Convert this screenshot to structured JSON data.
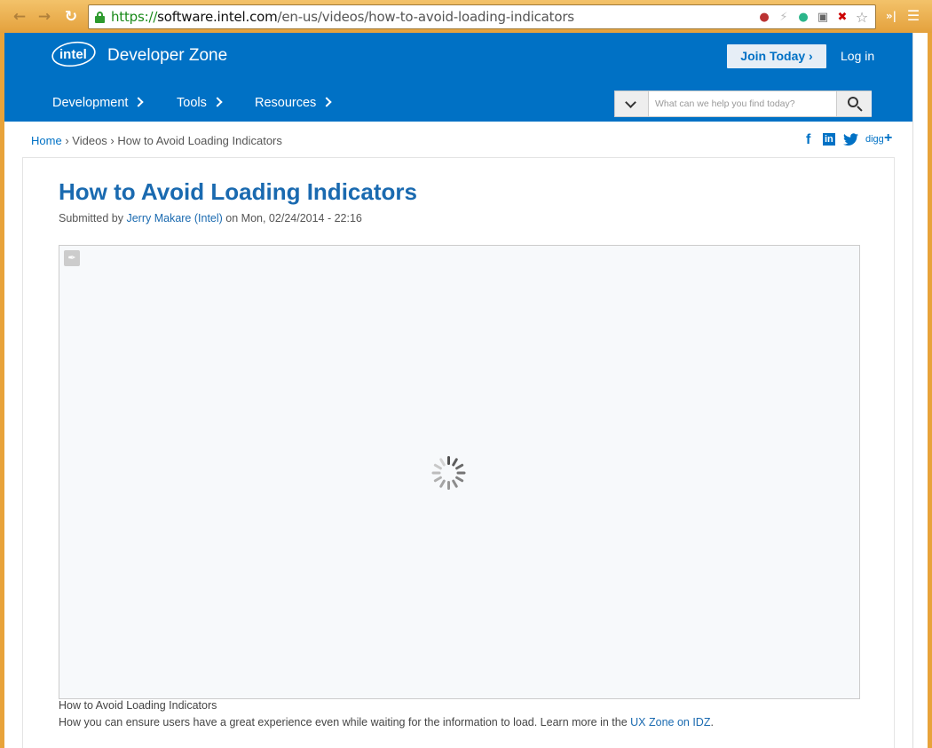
{
  "browser": {
    "url_scheme": "https://",
    "url_host": "software.intel.com",
    "url_path": "/en-us/videos/how-to-avoid-loading-indicators"
  },
  "header": {
    "logo_text": "intel",
    "title": "Developer Zone",
    "join_label": "Join Today",
    "login_label": "Log in",
    "nav": [
      "Development",
      "Tools",
      "Resources"
    ],
    "search_placeholder": "What can we help you find today?"
  },
  "breadcrumb": {
    "home": "Home",
    "sep": "›",
    "videos": "Videos",
    "current": "How to Avoid Loading Indicators"
  },
  "share": {
    "facebook": "f",
    "linkedin": "in",
    "digg": "digg",
    "more": "+"
  },
  "article": {
    "title": "How to Avoid Loading Indicators",
    "submitted_prefix": "Submitted by",
    "author": "Jerry Makare (Intel)",
    "submitted_on": "on Mon, 02/24/2014 - 22:16",
    "caption": "How to Avoid Loading Indicators",
    "desc_text": "How you can ensure users have a great experience even while waiting for the information to load. Learn more in the",
    "desc_link": "UX Zone on IDZ",
    "desc_end": "."
  },
  "colors": {
    "header_blue": "#0071c5",
    "link_blue": "#1a6ab0",
    "chrome_orange": "#e8a33a"
  }
}
